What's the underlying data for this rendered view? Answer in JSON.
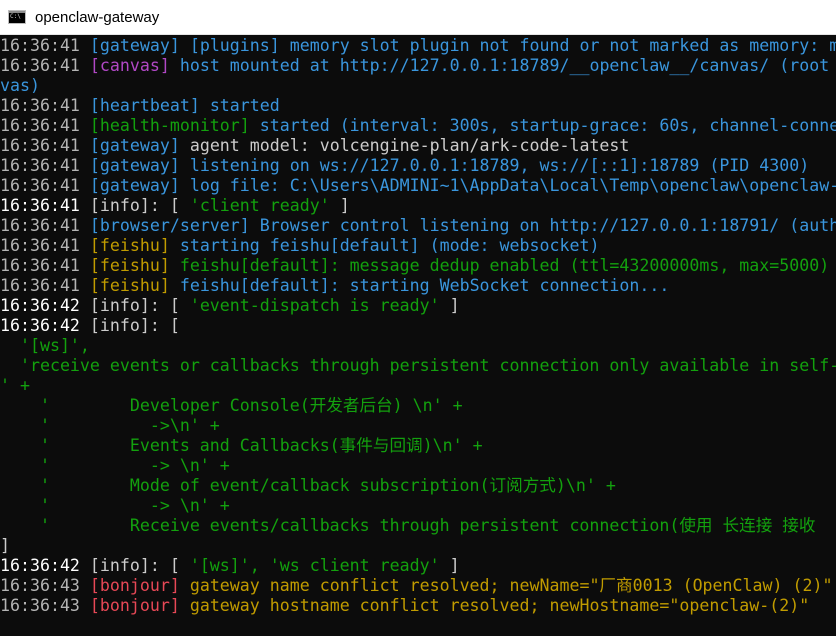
{
  "window": {
    "title": "openclaw-gateway",
    "icon": "cmd-icon"
  },
  "lines": [
    {
      "ts": "16:36:41 ",
      "tag": "[gateway]",
      "msg": " [plugins] memory slot plugin not found or not marked as memory: m"
    },
    {
      "ts": "16:36:41 ",
      "tag": "[canvas]",
      "msg": " host mounted at http://127.0.0.1:18789/__openclaw__/canvas/ (root"
    },
    {
      "text": "vas)"
    },
    {
      "ts": "16:36:41 ",
      "tag": "[heartbeat]",
      "msg": " started"
    },
    {
      "ts": "16:36:41 ",
      "tag": "[health-monitor]",
      "msg": " started (interval: 300s, startup-grace: 60s, channel-conne"
    },
    {
      "ts": "16:36:41 ",
      "tag": "[gateway]",
      "msg": " agent model: volcengine-plan/ark-code-latest"
    },
    {
      "ts": "16:36:41 ",
      "tag": "[gateway]",
      "msg": " listening on ws://127.0.0.1:18789, ws://[::1]:18789 (PID 4300)"
    },
    {
      "ts": "16:36:41 ",
      "tag": "[gateway]",
      "msg": " log file: C:\\Users\\ADMINI~1\\AppData\\Local\\Temp\\openclaw\\openclaw-"
    },
    {
      "ts": "16:36:41 ",
      "prefix": "[info]: [ ",
      "str": "'client ready'",
      "suffix": " ]"
    },
    {
      "ts": "16:36:41 ",
      "tag": "[browser/server]",
      "msg": " Browser control listening on http://127.0.0.1:18791/ (auth"
    },
    {
      "ts": "16:36:41 ",
      "tag": "[feishu]",
      "msg": " starting feishu[default] (mode: websocket)"
    },
    {
      "ts": "16:36:41 ",
      "tag": "[feishu]",
      "msg": " feishu[default]: message dedup enabled (ttl=43200000ms, max=5000)"
    },
    {
      "ts": "16:36:41 ",
      "tag": "[feishu]",
      "msg": " feishu[default]: starting WebSocket connection..."
    },
    {
      "ts": "16:36:42 ",
      "prefix": "[info]: [ ",
      "str": "'event-dispatch is ready'",
      "suffix": " ]"
    },
    {
      "ts": "16:36:42 ",
      "prefix": "[info]: ["
    },
    {
      "text": "  '[ws]',"
    },
    {
      "text": "  'receive events or callbacks through persistent connection only available in self-"
    },
    {
      "text": "' +"
    },
    {
      "text": "    '        Developer Console(开发者后台) \\n' +"
    },
    {
      "text": "    '          ->\\n' +"
    },
    {
      "text": "    '        Events and Callbacks(事件与回调)\\n' +"
    },
    {
      "text": "    '          -> \\n' +"
    },
    {
      "text": "    '        Mode of event/callback subscription(订阅方式)\\n' +"
    },
    {
      "text": "    '          -> \\n' +"
    },
    {
      "text": "    '        Receive events/callbacks through persistent connection(使用 长连接 接收"
    },
    {
      "text": "]"
    },
    {
      "ts": "16:36:42 ",
      "prefix": "[info]: [ ",
      "str": "'[ws]', 'ws client ready'",
      "suffix": " ]"
    },
    {
      "ts": "16:36:43 ",
      "tag": "[bonjour]",
      "msg": " gateway name conflict resolved; newName=\"厂商0013 (OpenClaw) (2)\""
    },
    {
      "ts": "16:36:43 ",
      "tag": "[bonjour]",
      "msg": " gateway hostname conflict resolved; newHostname=\"openclaw-(2)\""
    }
  ]
}
